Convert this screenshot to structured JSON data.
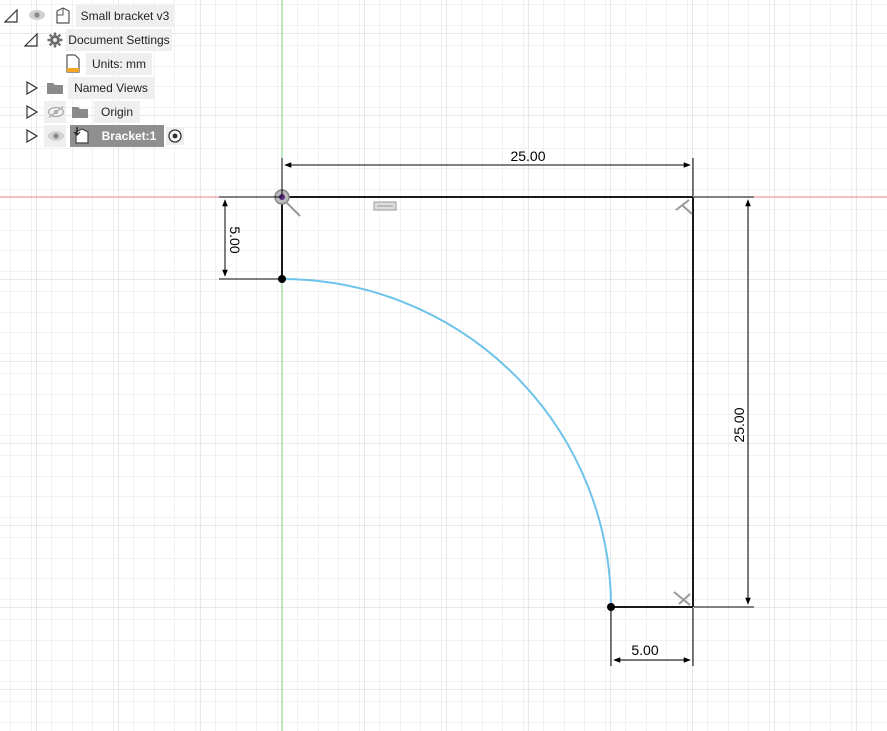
{
  "browser": {
    "root": {
      "label": "Small bracket v3"
    },
    "document_settings": {
      "label": "Document Settings"
    },
    "units": {
      "label": "Units: mm"
    },
    "named_views": {
      "label": "Named Views"
    },
    "origin": {
      "label": "Origin"
    },
    "component": {
      "label": "Bracket:1"
    }
  },
  "sketch": {
    "dimensions": {
      "top_width": "25.00",
      "right_height": "25.00",
      "left_height": "5.00",
      "bottom_width": "5.00"
    },
    "colors": {
      "grid_minor": "#e6e6e6",
      "grid_major": "#cfcfcf",
      "x_axis": "#f08080",
      "y_axis": "#7fd07f",
      "profile": "#1a1a1a",
      "arc": "#6ec3ea",
      "dimension": "#000000"
    }
  }
}
